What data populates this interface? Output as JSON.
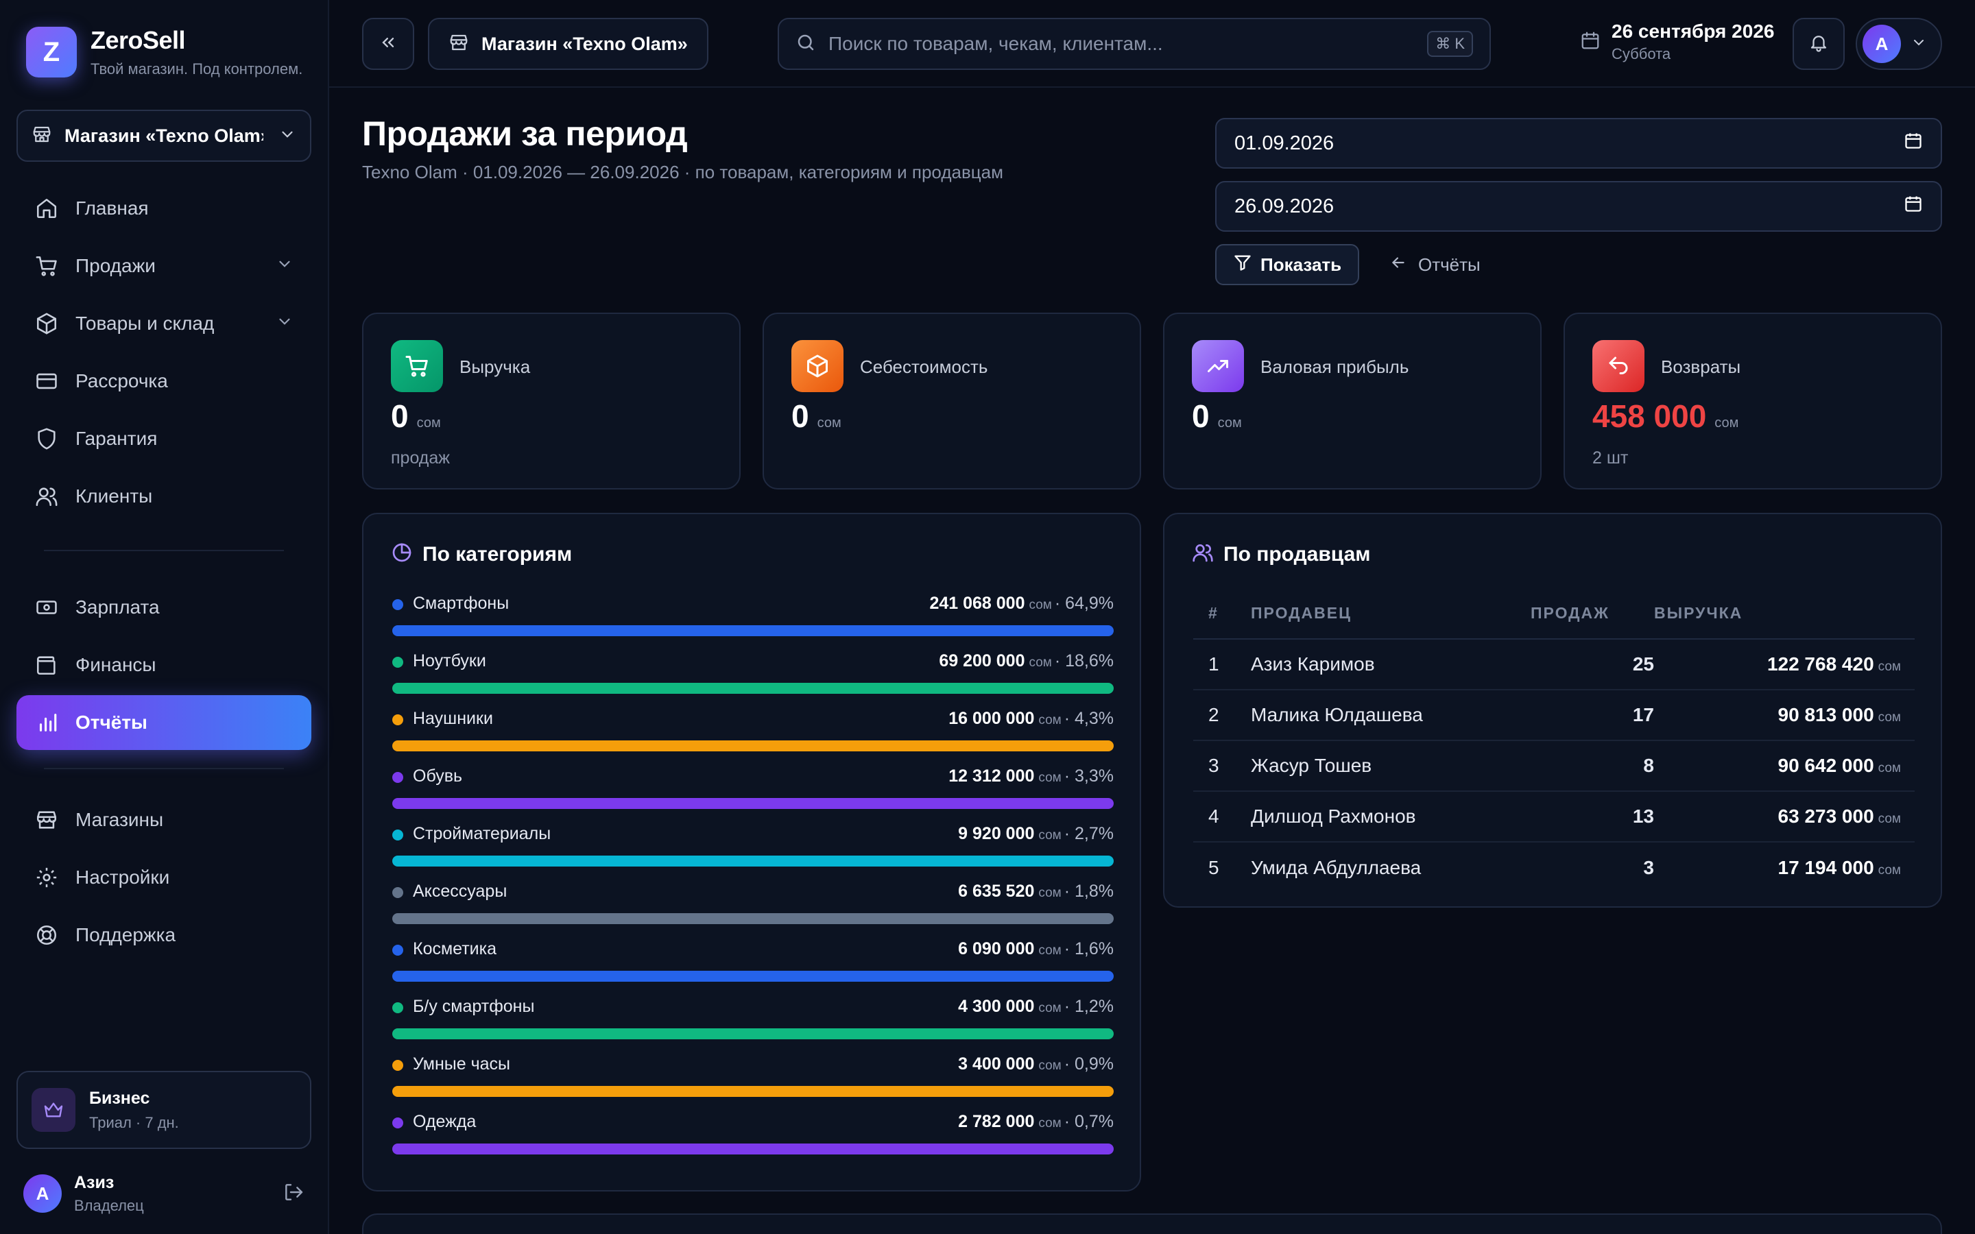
{
  "colors": {
    "accent_start": "#7c3aed",
    "accent_end": "#3b82f6",
    "returns": "#ef4444",
    "revenue_icon": "#10b981",
    "cost_icon": "#f97316",
    "profit_icon": "#8b5cf6",
    "returns_icon": "#ef4444"
  },
  "brand": {
    "logo_letter": "Z",
    "name": "ZeroSell",
    "tagline": "Твой магазин. Под контролем."
  },
  "sidebar": {
    "store_select": "Магазин «Texno Olam»",
    "items": [
      {
        "label": "Главная",
        "icon": "home-icon"
      },
      {
        "label": "Продажи",
        "icon": "cart-icon",
        "expandable": true
      },
      {
        "label": "Товары и склад",
        "icon": "box-icon",
        "expandable": true
      },
      {
        "label": "Рассрочка",
        "icon": "credit-card-icon"
      },
      {
        "label": "Гарантия",
        "icon": "shield-icon"
      },
      {
        "label": "Клиенты",
        "icon": "users-icon"
      },
      {
        "label": "Зарплата",
        "icon": "banknote-icon"
      },
      {
        "label": "Финансы",
        "icon": "wallet-icon"
      },
      {
        "label": "Отчёты",
        "icon": "bar-chart-icon",
        "active": true
      },
      {
        "label": "Магазины",
        "icon": "store-icon"
      },
      {
        "label": "Настройки",
        "icon": "gear-icon"
      },
      {
        "label": "Поддержка",
        "icon": "lifebuoy-icon"
      }
    ],
    "plan": {
      "title": "Бизнес",
      "subtitle": "Триал · 7 дн.",
      "icon": "crown-icon"
    },
    "user": {
      "initial": "A",
      "name": "Азиз",
      "role": "Владелец"
    }
  },
  "topbar": {
    "store": "Магазин «Texno Olam»",
    "search_placeholder": "Поиск по товарам, чекам, клиентам...",
    "shortcut": "⌘ K",
    "date": "26 сентября 2026",
    "weekday": "Суббота",
    "avatar_initial": "A"
  },
  "page": {
    "title": "Продажи за период",
    "subtitle": "Texno Olam · 01.09.2026 — 26.09.2026 · по товарам, категориям и продавцам",
    "date_from": "01.09.2026",
    "date_to": "26.09.2026",
    "show_button": "Показать",
    "back_link": "Отчёты"
  },
  "kpis": [
    {
      "label": "Выручка",
      "value": "0",
      "unit": "сом",
      "foot": "продаж",
      "icon": "cart-icon"
    },
    {
      "label": "Себестоимость",
      "value": "0",
      "unit": "сом",
      "foot": "",
      "icon": "package-icon"
    },
    {
      "label": "Валовая прибыль",
      "value": "0",
      "unit": "сом",
      "foot": "",
      "icon": "trending-up-icon"
    },
    {
      "label": "Возвраты",
      "value": "458 000",
      "unit": "сом",
      "foot": "2 шт",
      "icon": "undo-icon"
    }
  ],
  "categories": {
    "title": "По категориям",
    "unit": "сом",
    "items": [
      {
        "name": "Смартфоны",
        "amount": "241 068 000",
        "share": "64,9%",
        "color": "#2563eb"
      },
      {
        "name": "Ноутбуки",
        "amount": "69 200 000",
        "share": "18,6%",
        "color": "#10b981"
      },
      {
        "name": "Наушники",
        "amount": "16 000 000",
        "share": "4,3%",
        "color": "#f59e0b"
      },
      {
        "name": "Обувь",
        "amount": "12 312 000",
        "share": "3,3%",
        "color": "#7c3aed"
      },
      {
        "name": "Стройматериалы",
        "amount": "9 920 000",
        "share": "2,7%",
        "color": "#06b6d4"
      },
      {
        "name": "Аксессуары",
        "amount": "6 635 520",
        "share": "1,8%",
        "color": "#64748b"
      },
      {
        "name": "Косметика",
        "amount": "6 090 000",
        "share": "1,6%",
        "color": "#2563eb"
      },
      {
        "name": "Б/у смартфоны",
        "amount": "4 300 000",
        "share": "1,2%",
        "color": "#10b981"
      },
      {
        "name": "Умные часы",
        "amount": "3 400 000",
        "share": "0,9%",
        "color": "#f59e0b"
      },
      {
        "name": "Одежда",
        "amount": "2 782 000",
        "share": "0,7%",
        "color": "#7c3aed"
      }
    ]
  },
  "sellers": {
    "title": "По продавцам",
    "columns": [
      "#",
      "ПРОДАВЕЦ",
      "ПРОДАЖ",
      "ВЫРУЧКА"
    ],
    "unit": "сом",
    "rows": [
      {
        "n": "1",
        "name": "Азиз Каримов",
        "sales": "25",
        "revenue": "122 768 420"
      },
      {
        "n": "2",
        "name": "Малика Юлдашева",
        "sales": "17",
        "revenue": "90 813 000"
      },
      {
        "n": "3",
        "name": "Жасур Тошев",
        "sales": "8",
        "revenue": "90 642 000"
      },
      {
        "n": "4",
        "name": "Дилшод Рахмонов",
        "sales": "13",
        "revenue": "63 273 000"
      },
      {
        "n": "5",
        "name": "Умида Абдуллаева",
        "sales": "3",
        "revenue": "17 194 000"
      }
    ]
  }
}
